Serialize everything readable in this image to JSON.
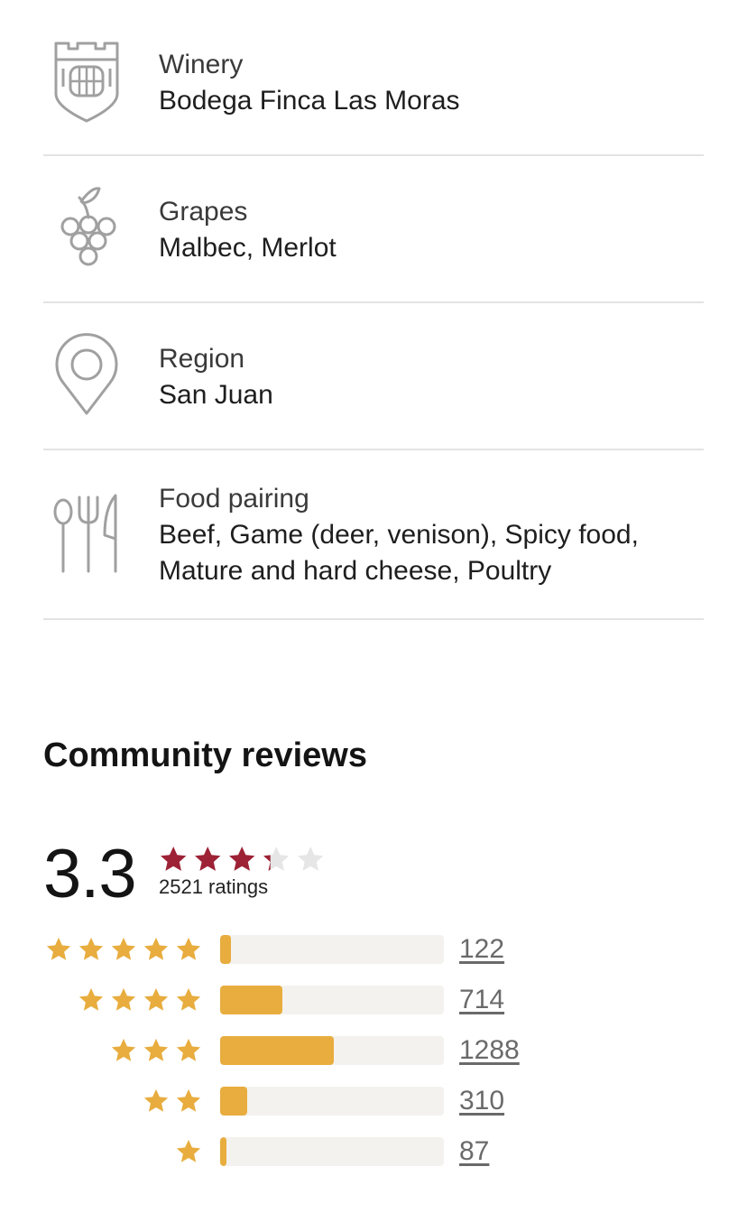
{
  "facts": [
    {
      "icon": "winery-castle-icon",
      "label": "Winery",
      "value": "Bodega Finca Las Moras"
    },
    {
      "icon": "grapes-icon",
      "label": "Grapes",
      "value": "Malbec, Merlot"
    },
    {
      "icon": "location-pin-icon",
      "label": "Region",
      "value": "San Juan"
    },
    {
      "icon": "cutlery-icon",
      "label": "Food pairing",
      "value": "Beef, Game (deer, venison), Spicy food, Mature and hard cheese, Poultry"
    }
  ],
  "reviews": {
    "title": "Community reviews",
    "average": "3.3",
    "average_value": 3.3,
    "ratings_count": "2521 ratings",
    "distribution": [
      {
        "stars": 5,
        "count": "122",
        "fill": 0.05
      },
      {
        "stars": 4,
        "count": "714",
        "fill": 0.28
      },
      {
        "stars": 3,
        "count": "1288",
        "fill": 0.51
      },
      {
        "stars": 2,
        "count": "310",
        "fill": 0.12
      },
      {
        "stars": 1,
        "count": "87",
        "fill": 0.03
      }
    ]
  },
  "colors": {
    "accent_red": "#9d2236",
    "star_gold": "#e8ad3e",
    "star_empty": "#e6e6e6",
    "icon_gray": "#a0a0a0",
    "divider": "#e3e3e3"
  }
}
